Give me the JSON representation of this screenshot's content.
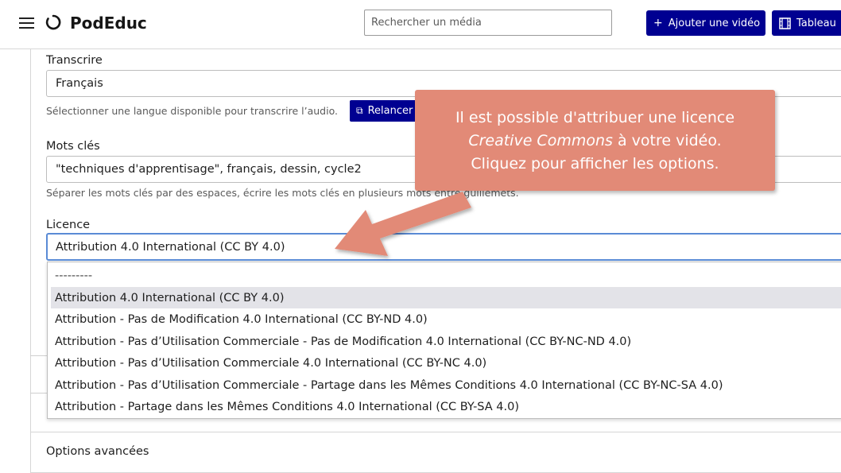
{
  "header": {
    "app_name": "PodEduc",
    "search_placeholder": "Rechercher un média",
    "add_video_label": "Ajouter une vidéo",
    "add_video_icon": "+",
    "dashboard_label": "Tableau",
    "dashboard_icon": "film-icon"
  },
  "form": {
    "transcribe_label": "Transcrire",
    "transcribe_value": "Français",
    "transcribe_hint": "Sélectionner une langue disponible pour transcrire l’audio.",
    "relaunch_label": "Relancer",
    "keywords_label": "Mots clés",
    "keywords_value": "\"techniques d'apprentisage\", français, dessin, cycle2",
    "keywords_hint": "Séparer les mots clés par des espaces, écrire les mots clés en plusieurs mots entre guillemets.",
    "licence_label": "Licence",
    "licence_value": "Attribution 4.0 International (CC BY 4.0)",
    "licence_options": [
      "---------",
      "Attribution 4.0 International (CC BY 4.0)",
      "Attribution - Pas de Modification 4.0 International (CC BY-ND 4.0)",
      "Attribution - Pas d’Utilisation Commerciale - Pas de Modification 4.0 International (CC BY-NC-ND 4.0)",
      "Attribution - Pas d’Utilisation Commerciale 4.0 International (CC BY-NC 4.0)",
      "Attribution - Pas d’Utilisation Commerciale - Partage dans les Mêmes Conditions 4.0 International (CC BY-NC-SA 4.0)",
      "Attribution - Partage dans les Mêmes Conditions 4.0 International (CC BY-SA 4.0)"
    ],
    "advanced_label": "Options avancées"
  },
  "callout": {
    "line1": "Il est possible d'attribuer une licence",
    "line2_italic": "Creative Commons",
    "line2_rest": " à votre vidéo.",
    "line3": "Cliquez pour afficher les options."
  },
  "colors": {
    "primary": "#000091",
    "callout": "#e28a77",
    "focus_border": "#5a8bd6"
  }
}
